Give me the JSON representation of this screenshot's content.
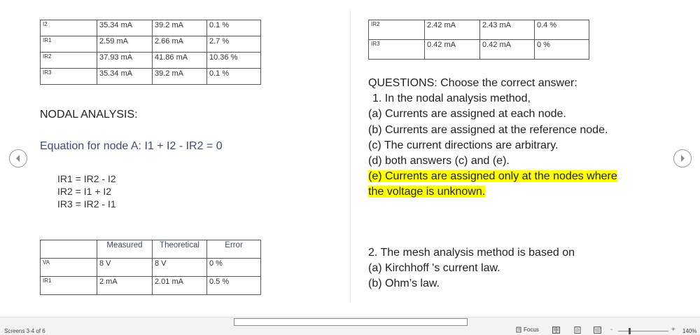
{
  "tables": {
    "top_left": [
      [
        "I2",
        "35.34 mA",
        "39.2 mA",
        "0.1 %"
      ],
      [
        "IR1",
        "2.59 mA",
        "2.66 mA",
        "2.7 %"
      ],
      [
        "IR2",
        "37.93 mA",
        "41.86 mA",
        "10.36 %"
      ],
      [
        "IR3",
        "35.34 mA",
        "39.2 mA",
        "0.1 %"
      ]
    ],
    "top_right": [
      [
        "IR2",
        "2.42 mA",
        "2.43 mA",
        "0.4 %"
      ],
      [
        "IR3",
        "0.42 mA",
        "0.42 mA",
        "0 %"
      ]
    ],
    "bottom_left": {
      "headers": [
        "",
        "Measured",
        "Theoretical",
        "Error"
      ],
      "rows": [
        [
          "VA",
          "8 V",
          "8 V",
          "0 %"
        ],
        [
          "IR1",
          "2 mA",
          "2.01 mA",
          "0.5 %"
        ]
      ]
    }
  },
  "left_page": {
    "heading": "NODAL ANALYSIS:",
    "equation": "Equation for node A: I1 + I2 - IR2 = 0",
    "relations": [
      "IR1 = IR2 - I2",
      "IR2 = I1 + I2",
      "IR3 = IR2 - I1"
    ]
  },
  "right_page": {
    "questions_title": "QUESTIONS: Choose the correct answer:",
    "q1": "1. In the nodal analysis method,",
    "q1_options": [
      "(a) Currents are assigned at each node.",
      "(b) Currents are assigned at the reference node.",
      "(c) The current directions are arbitrary.",
      "(d) both answers (c) and (e)."
    ],
    "q1_highlight_line1": "(e) Currents are assigned only at the nodes where",
    "q1_highlight_line2": "the voltage is unknown.",
    "q2": "2. The mesh analysis method is based on",
    "q2_options": [
      "(a) Kirchhoff 's current law.",
      "(b) Ohm’s law."
    ]
  },
  "status": {
    "page_info": "Screens 3-4 of 6",
    "focus_label": "Focus",
    "zoom_minus": "-",
    "zoom_plus": "+",
    "zoom_level": "140%",
    "zoom_fraction": 0.2
  },
  "colors": {
    "highlight": "#ffff00",
    "equation_text": "#3b4f78"
  }
}
